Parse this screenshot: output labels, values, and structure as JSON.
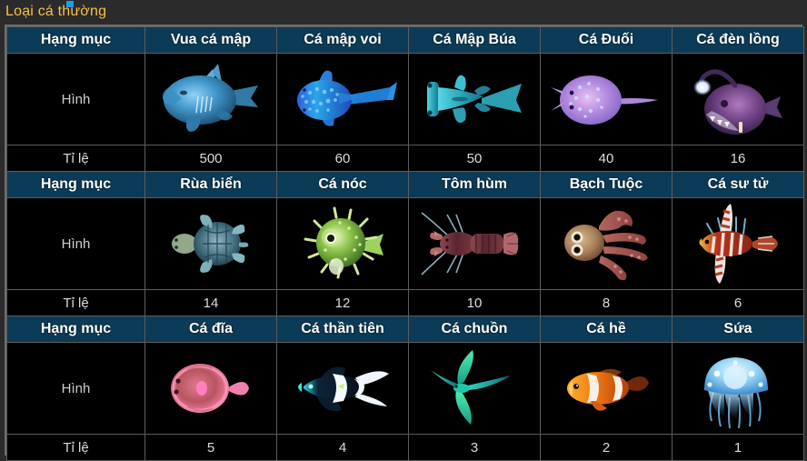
{
  "title": "Loại cá thường",
  "row_labels": {
    "image": "Hình",
    "ratio": "Tỉ lệ",
    "category": "Hạng mục"
  },
  "colors": {
    "title_text": "#f5c242",
    "header_bg": "#0c3b57",
    "header_text": "#ffffff",
    "cell_bg": "#000000",
    "border": "#5d5d5d",
    "page_bg": "#2b2b2b",
    "marker": "#1e9de0"
  },
  "groups": [
    {
      "category_label": "Hạng mục",
      "image_label": "Hình",
      "ratio_label": "Tỉ lệ",
      "items": [
        {
          "name": "Vua cá mập",
          "ratio": "500",
          "icon": "shark-king-icon"
        },
        {
          "name": "Cá mập voi",
          "ratio": "60",
          "icon": "whale-shark-icon"
        },
        {
          "name": "Cá Mập Búa",
          "ratio": "50",
          "icon": "hammerhead-shark-icon"
        },
        {
          "name": "Cá Đuối",
          "ratio": "40",
          "icon": "stingray-icon"
        },
        {
          "name": "Cá đèn lồng",
          "ratio": "16",
          "icon": "anglerfish-icon"
        }
      ]
    },
    {
      "category_label": "Hạng mục",
      "image_label": "Hình",
      "ratio_label": "Tỉ lệ",
      "items": [
        {
          "name": "Rùa biển",
          "ratio": "14",
          "icon": "sea-turtle-icon"
        },
        {
          "name": "Cá nóc",
          "ratio": "12",
          "icon": "pufferfish-icon"
        },
        {
          "name": "Tôm hùm",
          "ratio": "10",
          "icon": "lobster-icon"
        },
        {
          "name": "Bạch Tuộc",
          "ratio": "8",
          "icon": "octopus-icon"
        },
        {
          "name": "Cá sư tử",
          "ratio": "6",
          "icon": "lionfish-icon"
        }
      ]
    },
    {
      "category_label": "Hạng mục",
      "image_label": "Hình",
      "ratio_label": "Tỉ lệ",
      "items": [
        {
          "name": "Cá đĩa",
          "ratio": "5",
          "icon": "discus-fish-icon"
        },
        {
          "name": "Cá thần tiên",
          "ratio": "4",
          "icon": "angelfish-icon"
        },
        {
          "name": "Cá chuồn",
          "ratio": "3",
          "icon": "flying-fish-icon"
        },
        {
          "name": "Cá hề",
          "ratio": "2",
          "icon": "clownfish-icon"
        },
        {
          "name": "Sứa",
          "ratio": "1",
          "icon": "jellyfish-icon"
        }
      ]
    }
  ]
}
